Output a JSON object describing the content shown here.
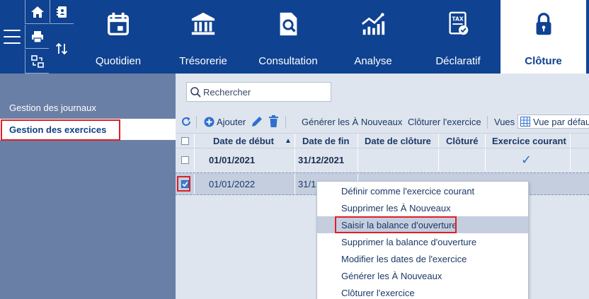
{
  "colors": {
    "nav_bg": "#0f4291",
    "sidebar_bg": "#6a7fa5",
    "main_bg": "#dfe5ee",
    "highlight": "#e01e26",
    "accent_blue": "#3b7fd8"
  },
  "nav": {
    "menu_icon": "hamburger-icon",
    "mini_icons": [
      "home-icon",
      "address-book-icon",
      "printer-icon",
      "transfer-icon",
      "sort-arrows-icon"
    ],
    "tabs": [
      {
        "label": "Quotidien",
        "icon": "calendar-icon"
      },
      {
        "label": "Trésorerie",
        "icon": "bank-icon"
      },
      {
        "label": "Consultation",
        "icon": "document-search-icon"
      },
      {
        "label": "Analyse",
        "icon": "chart-growth-icon"
      },
      {
        "label": "Déclaratif",
        "icon": "tax-document-icon"
      },
      {
        "label": "Clôture",
        "icon": "lock-icon",
        "active": true
      }
    ]
  },
  "sidebar": {
    "items": [
      {
        "label": "Gestion des journaux",
        "active": false
      },
      {
        "label": "Gestion des exercices",
        "active": true
      }
    ]
  },
  "search": {
    "placeholder": "Rechercher"
  },
  "toolbar": {
    "add_label": "Ajouter",
    "generate_label": "Générer les À Nouveaux",
    "close_label": "Clôturer l'exercice",
    "views_label": "Vues",
    "view_selected": "Vue par défaut"
  },
  "table": {
    "columns": [
      "Date de début",
      "Date de fin",
      "Date de clôture",
      "Clôturé",
      "Exercice courant"
    ],
    "sort_indicator": "▲",
    "rows": [
      {
        "start": "01/01/2021",
        "end": "31/12/2021",
        "closing": "",
        "closed": "",
        "current": "✓",
        "checked": false
      },
      {
        "start": "01/01/2022",
        "end": "31/1",
        "closing": "",
        "closed": "",
        "current": "",
        "checked": true
      }
    ]
  },
  "context_menu": {
    "items": [
      "Définir comme l'exercice courant",
      "Supprimer les À Nouveaux",
      "Saisir la balance d'ouverture",
      "Supprimer la balance d'ouverture",
      "Modifier les dates de l'exercice",
      "Générer les À Nouveaux",
      "Clôturer l'exercice"
    ],
    "hovered_index": 2
  }
}
